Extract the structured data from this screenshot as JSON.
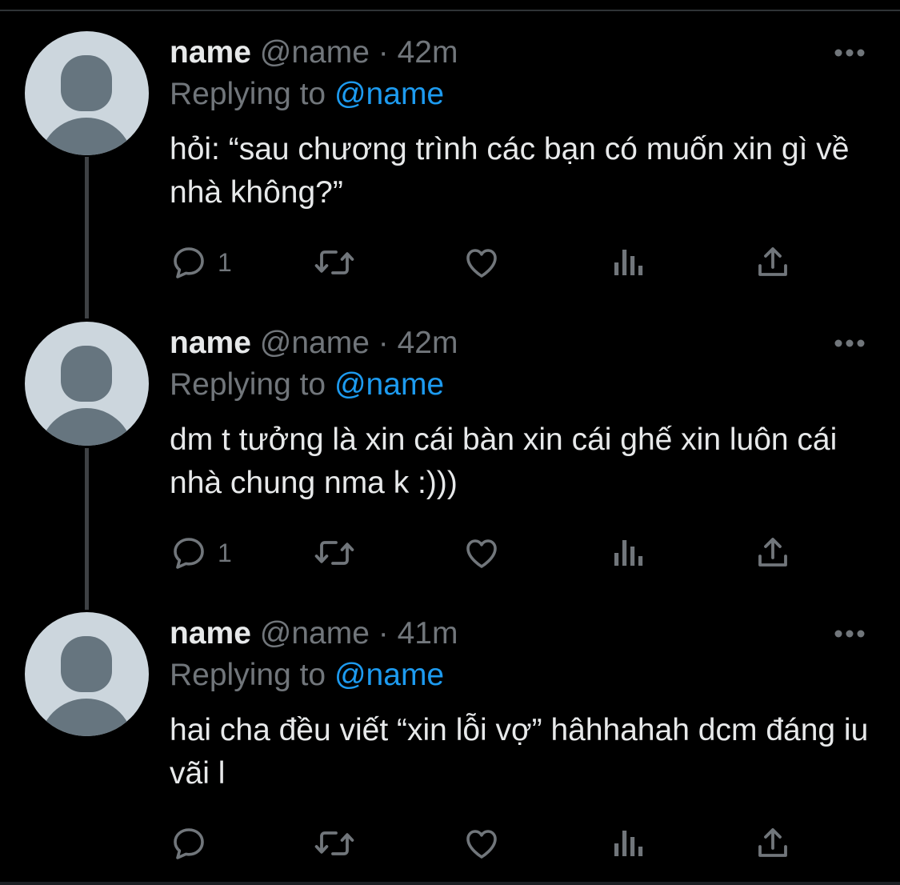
{
  "colors": {
    "background": "#000000",
    "text": "#e7e9ea",
    "muted": "#71767b",
    "link": "#1d9bf0",
    "avatar_bg": "#ccd6dd",
    "avatar_fg": "#66757f"
  },
  "tweets": [
    {
      "display_name": "name",
      "handle": "@name",
      "separator": "·",
      "time": "42m",
      "replying_label": "Replying to",
      "reply_to": "@name",
      "text": "hỏi: “sau chương trình các bạn có muốn xin gì về nhà không?”",
      "reply_count": "1",
      "icons": [
        "reply-icon",
        "retweet-icon",
        "like-icon",
        "views-icon",
        "share-icon",
        "more-icon"
      ]
    },
    {
      "display_name": "name",
      "handle": "@name",
      "separator": "·",
      "time": "42m",
      "replying_label": "Replying to",
      "reply_to": "@name",
      "text": "dm t tưởng là xin cái bàn xin cái ghế xin luôn cái nhà chung nma k :)))",
      "reply_count": "1",
      "icons": [
        "reply-icon",
        "retweet-icon",
        "like-icon",
        "views-icon",
        "share-icon",
        "more-icon"
      ]
    },
    {
      "display_name": "name",
      "handle": "@name",
      "separator": "·",
      "time": "41m",
      "replying_label": "Replying to",
      "reply_to": "@name",
      "text": "hai cha đều viết “xin lỗi vợ” hâhhahah dcm đáng iu vãi l",
      "reply_count": "",
      "icons": [
        "reply-icon",
        "retweet-icon",
        "like-icon",
        "views-icon",
        "share-icon",
        "more-icon"
      ]
    }
  ]
}
